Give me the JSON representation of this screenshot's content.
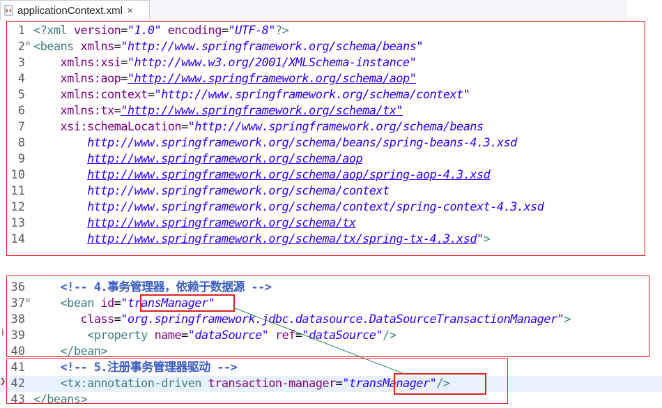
{
  "tab": {
    "label": "applicationContext.xml",
    "close": "✕",
    "icon": "xml-file-icon"
  },
  "lines": [
    {
      "num": "1",
      "code": "<?xml version=\"1.0\" encoding=\"UTF-8\"?>"
    },
    {
      "num": "2",
      "code": "<beans xmlns=\"http://www.springframework.org/schema/beans\""
    },
    {
      "num": "3",
      "code": "    xmlns:xsi=\"http://www.w3.org/2001/XMLSchema-instance\""
    },
    {
      "num": "4",
      "code": "    xmlns:aop=\"http://www.springframework.org/schema/aop\""
    },
    {
      "num": "5",
      "code": "    xmlns:context=\"http://www.springframework.org/schema/context\""
    },
    {
      "num": "6",
      "code": "    xmlns:tx=\"http://www.springframework.org/schema/tx\""
    },
    {
      "num": "7",
      "code": "    xsi:schemaLocation=\"http://www.springframework.org/schema/beans"
    },
    {
      "num": "8",
      "code": "        http://www.springframework.org/schema/beans/spring-beans-4.3.xsd"
    },
    {
      "num": "9",
      "code": "        http://www.springframework.org/schema/aop"
    },
    {
      "num": "10",
      "code": "        http://www.springframework.org/schema/aop/spring-aop-4.3.xsd"
    },
    {
      "num": "11",
      "code": "        http://www.springframework.org/schema/context"
    },
    {
      "num": "12",
      "code": "        http://www.springframework.org/schema/context/spring-context-4.3.xsd"
    },
    {
      "num": "13",
      "code": "        http://www.springframework.org/schema/tx"
    },
    {
      "num": "14",
      "code": "        http://www.springframework.org/schema/tx/spring-tx-4.3.xsd\">"
    },
    {
      "num": "36",
      "code": "    <!-- 4.事务管理器，依赖于数据源 -->"
    },
    {
      "num": "37",
      "code": "    <bean id=\"transManager\""
    },
    {
      "num": "38",
      "code": "       class=\"org.springframework.jdbc.datasource.DataSourceTransactionManager\">"
    },
    {
      "num": "39",
      "code": "        <property name=\"dataSource\" ref=\"dataSource\"/>"
    },
    {
      "num": "40",
      "code": "    </bean>"
    },
    {
      "num": "41",
      "code": "    <!-- 5.注册事务管理器驱动 -->"
    },
    {
      "num": "42",
      "code": "    <tx:annotation-driven transaction-manager=\"transManager\"/>"
    },
    {
      "num": "43",
      "code": "</beans>"
    }
  ],
  "colors": {
    "tag": "#3f7f7f",
    "attribute": "#7f007f",
    "value": "#2a00ff",
    "comment": "#3f5fbf",
    "highlight_box": "#e02020",
    "arrow": "#2e8b57",
    "current_line": "#e8f2fe"
  }
}
